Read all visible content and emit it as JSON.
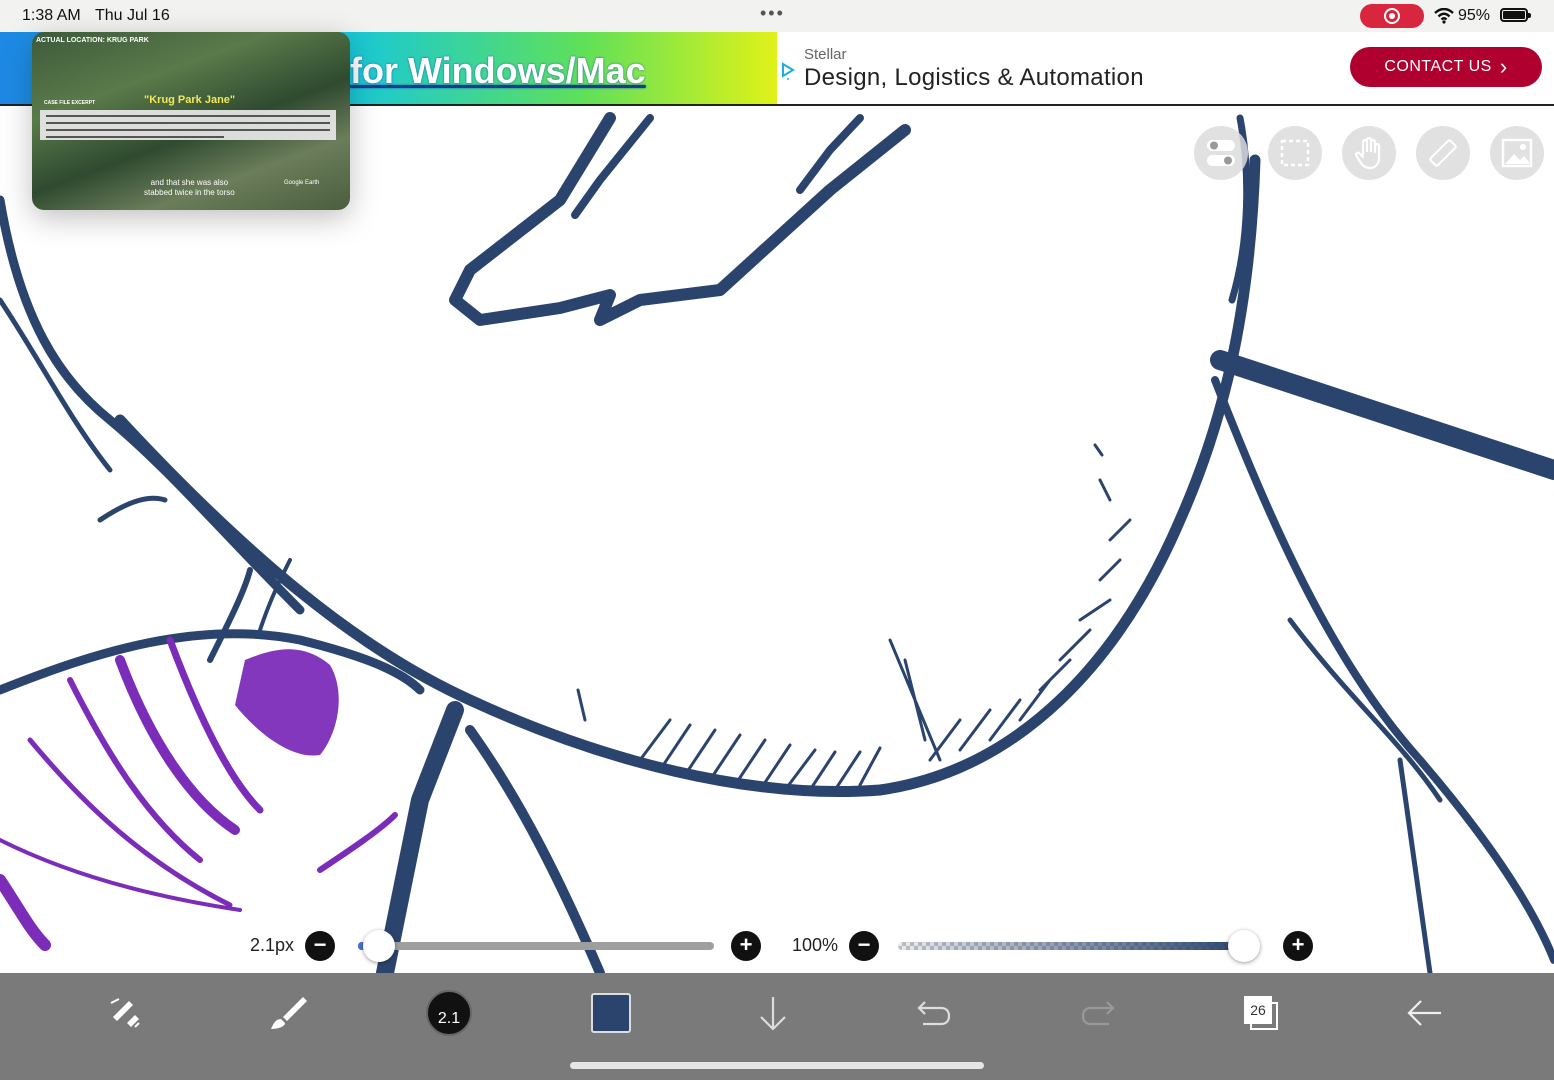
{
  "status_bar": {
    "time": "1:38 AM",
    "date": "Thu Jul 16",
    "multitask_dots": "•••",
    "battery_percent": "95%"
  },
  "ad": {
    "headline": "for Windows/Mac",
    "brand": "Stellar",
    "tagline": "Design, Logistics & Automation",
    "cta_label": "CONTACT US",
    "cta_chevron": "›",
    "cta_color": "#b00030"
  },
  "pip": {
    "location": "ACTUAL LOCATION: KRUG PARK",
    "case_label": "CASE FILE EXCERPT",
    "title": "\"Krug Park Jane\"",
    "caption_line1": "and that she was also",
    "caption_line2": "stabbed twice in the torso",
    "credit": "Google Earth"
  },
  "toolbar_top": {
    "icons": [
      "toggle-icon",
      "selection-icon",
      "hand-icon",
      "ruler-icon",
      "image-icon"
    ]
  },
  "brush": {
    "size_label": "2.1px",
    "size_value": 2.1,
    "opacity_label": "100%",
    "opacity_value": 100,
    "minus": "−",
    "plus": "+"
  },
  "bottom_bar": {
    "brush_size_badge": "2.1",
    "color": "#2b446e",
    "layer_count": "26"
  },
  "colors": {
    "line_art": "#2b446e",
    "accent_purple": "#7b2cb8"
  }
}
